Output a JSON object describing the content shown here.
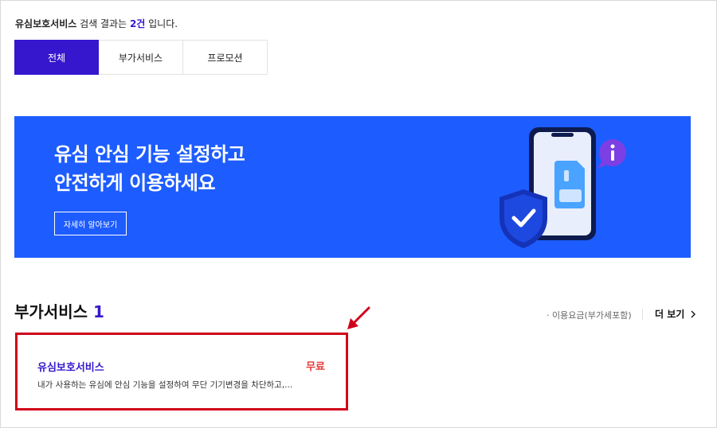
{
  "search_result": {
    "keyword": "유심보호서비스",
    "prefix_text": " 검색 결과는 ",
    "count": "2건",
    "suffix_text": " 입니다."
  },
  "tabs": [
    {
      "label": "전체",
      "active": true
    },
    {
      "label": "부가서비스",
      "active": false
    },
    {
      "label": "프로모션",
      "active": false
    }
  ],
  "banner": {
    "title_line1": "유심 안심 기능 설정하고",
    "title_line2": "안전하게 이용하세요",
    "button_label": "자세히 알아보기",
    "bg_color": "#1d5cff"
  },
  "section": {
    "title": "부가서비스",
    "count": "1",
    "fee_link": "· 이용요금(부가세포함)",
    "more_label": "더 보기",
    "more_icon": "chevron-right-icon"
  },
  "service_card": {
    "name": "유심보호서비스",
    "price": "무료",
    "description": "내가 사용하는 유심에 안심 기능을 설정하여 무단 기기변경을 차단하고,..."
  },
  "colors": {
    "accent": "#3617ce",
    "highlight": "#d0021b",
    "price": "#e63a3a"
  }
}
